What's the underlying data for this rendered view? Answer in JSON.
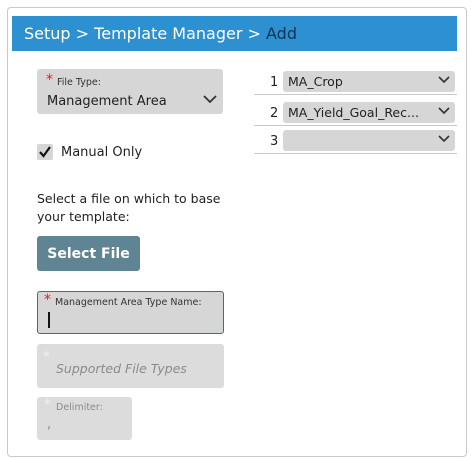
{
  "header": {
    "crumb_setup": "Setup",
    "sep1": ">",
    "crumb_template_manager": "Template Manager",
    "sep2": ">",
    "crumb_add": "Add"
  },
  "file_type": {
    "required_mark": "*",
    "label": "File Type:",
    "value": "Management Area"
  },
  "manual_only": {
    "label": "Manual Only",
    "checked": true
  },
  "select_file": {
    "prompt_line1": "Select a file on which to base",
    "prompt_line2": "your template:",
    "button_label": "Select File"
  },
  "type_name": {
    "required_mark": "*",
    "label": "Management Area Type Name:",
    "value": ""
  },
  "supported_types": {
    "required_mark": "*",
    "placeholder": "Supported File Types"
  },
  "delimiter": {
    "required_mark": "*",
    "label": "Delimiter:",
    "value": ","
  },
  "columns": [
    {
      "index": "1",
      "value": "MA_Crop"
    },
    {
      "index": "2",
      "value": "MA_Yield_Goal_Rec..."
    },
    {
      "index": "3",
      "value": ""
    }
  ],
  "colors": {
    "header_bg": "#2d90d0",
    "button_bg": "#5f8595",
    "field_bg": "#d6d6d6",
    "focus_border": "#3f7d3f",
    "required": "#e02020"
  }
}
